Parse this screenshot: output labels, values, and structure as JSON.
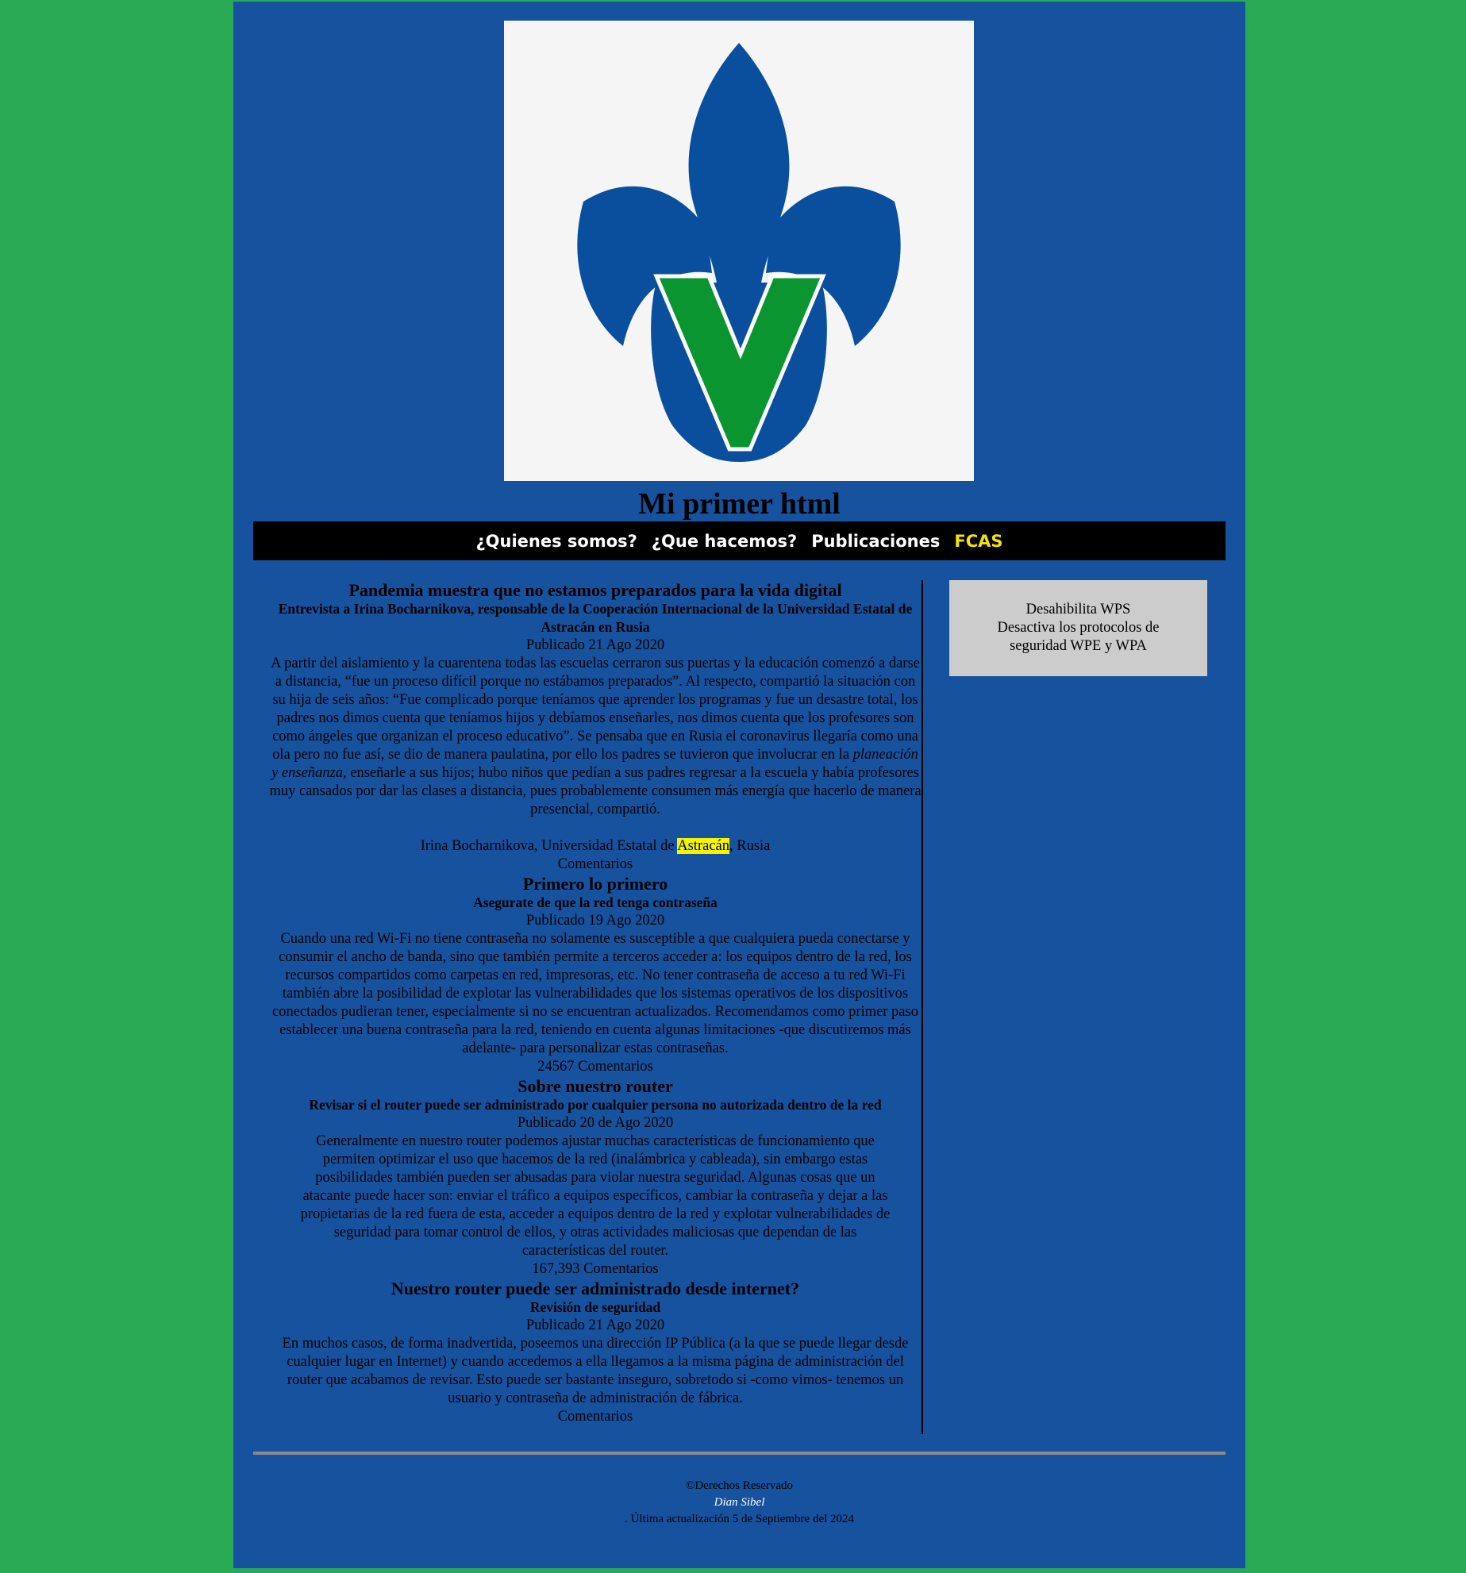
{
  "header": {
    "title": "Mi primer html"
  },
  "logo": {
    "colors": {
      "blue": "#0a4f9e",
      "green": "#0a9530",
      "background": "#f5f5f5"
    }
  },
  "nav": {
    "items": [
      {
        "label": "¿Quienes somos?"
      },
      {
        "label": "¿Que hacemos?"
      },
      {
        "label": "Publicaciones"
      },
      {
        "label": "FCAS"
      }
    ],
    "accent_color": "#f5e400"
  },
  "articles": [
    {
      "title": "Pandemia muestra que no estamos preparados para la vida digital",
      "subtitle": "Entrevista a Irina Bocharnikova, responsable de la Cooperación Internacional de la Universidad Estatal de Astracán en Rusia",
      "date": "Publicado 21 Ago 2020",
      "body_before_em": "A partir del aislamiento y la cuarentena todas las escuelas cerraron sus puertas y la educación comenzó a darse a distancia, “fue un proceso difícil porque no estábamos preparados”. Al respecto, compartió la situación con su hija de seis años: “Fue complicado porque teníamos que aprender los programas y fue un desastre total, los padres nos dimos cuenta que teníamos hijos y debíamos enseñarles, nos dimos cuenta que los profesores son como ángeles que organizan el proceso educativo”. Se pensaba que en Rusia el coronavirus llegaría como una ola pero no fue así, se dio de manera paulatina, por ello los padres se tuvieron que involucrar en la ",
      "body_em": "planeación y enseñanza",
      "body_after_em": ", enseñarle a sus hijos; hubo niños que pedían a sus padres regresar a la escuela y había profesores muy cansados por dar las clases a distancia, pues probablemente consumen más energía que hacerlo de manera presencial, compartió.",
      "credit_before": "Irina Bocharnikova, Universidad Estatal de ",
      "credit_highlight": "Astracán",
      "credit_after": ", Rusia",
      "comments": "Comentarios"
    },
    {
      "title": "Primero lo primero",
      "subtitle": "Asegurate de que la red tenga contraseña",
      "date": "Publicado 19 Ago 2020",
      "body": "Cuando una red Wi-Fi no tiene contraseña no solamente es susceptible a que cualquiera pueda conectarse y consumir el ancho de banda, sino que también permite a terceros acceder a: los equipos dentro de la red, los recursos compartidos como carpetas en red, impresoras, etc. No tener contraseña de acceso a tu red Wi-Fi también abre la posibilidad de explotar las vulnerabilidades que los sistemas operativos de los dispositivos conectados pudieran tener, especialmente si no se encuentran actualizados. Recomendamos como primer paso establecer una buena contraseña para la red, teniendo en cuenta algunas limitaciones -que discutiremos más adelante- para personalizar estas contraseñas.",
      "comments": "24567 Comentarios"
    },
    {
      "title": "Sobre nuestro router",
      "subtitle": "Revisar si el router puede ser administrado por cualquier persona no autorizada dentro de la red",
      "date": "Publicado 20 de Ago 2020",
      "body": "Generalmente en nuestro router podemos ajustar muchas características de funcionamiento que permiten optimizar el uso que hacemos de la red (inalámbrica y cableada), sin embargo estas posibilidades también pueden ser abusadas para violar nuestra seguridad. Algunas cosas que un atacante puede hacer son: enviar el tráfico a equipos específicos, cambiar la contraseña y dejar a las propietarias de la red fuera de esta, acceder a equipos dentro de la red y explotar vulnerabilidades de seguridad para tomar control de ellos, y otras actividades maliciosas que dependan de las características del router.",
      "comments": "167,393 Comentarios"
    },
    {
      "title": "Nuestro router puede ser administrado desde internet?",
      "subtitle": "Revisión de seguridad",
      "date": "Publicado 21 Ago 2020",
      "body": "En muchos casos, de forma inadvertida, poseemos una dirección IP Pública (a la que se puede llegar desde cualquier lugar en Internet) y cuando accedemos a ella llegamos a la misma página de administración del router que acabamos de revisar. Esto puede ser bastante inseguro, sobretodo si -como vimos- tenemos un usuario y contraseña de administración de fábrica.",
      "comments": "Comentarios"
    }
  ],
  "aside": {
    "line1": "Desahibilita WPS",
    "line2": "Desactiva los protocolos de seguridad WPE y WPA"
  },
  "footer": {
    "copyright": "©Derechos Reservado",
    "author": "Dian Sibel",
    "updated": ". Última actualización 5 de Septiembre del 2024"
  }
}
